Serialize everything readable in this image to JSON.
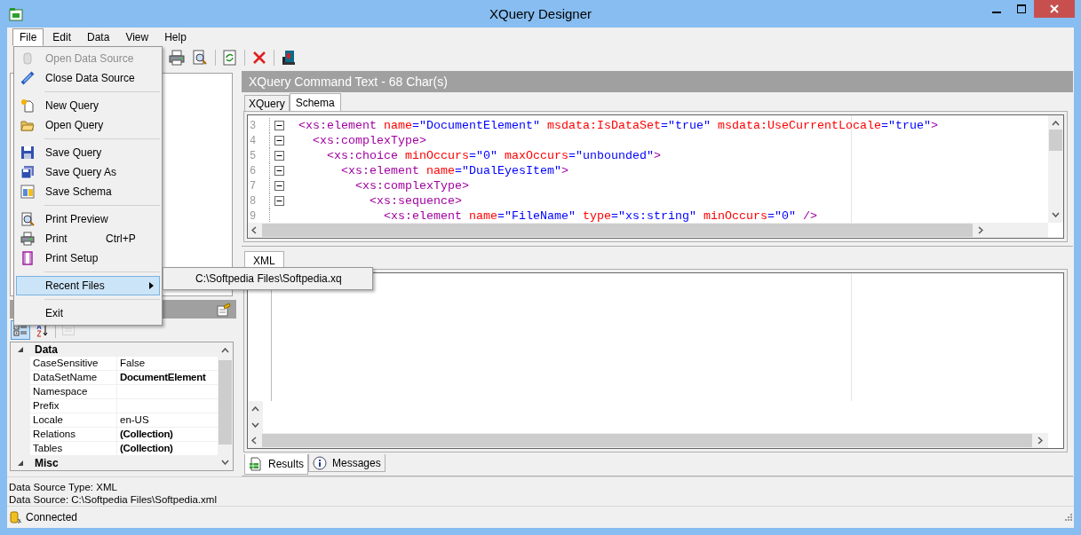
{
  "window": {
    "title": "XQuery Designer"
  },
  "menu_bar": [
    {
      "label": "File",
      "selected": true
    },
    {
      "label": "Edit",
      "selected": false
    },
    {
      "label": "Data",
      "selected": false
    },
    {
      "label": "View",
      "selected": false
    },
    {
      "label": "Help",
      "selected": false
    }
  ],
  "file_menu": [
    {
      "kind": "item",
      "label": "Open Data Source",
      "disabled": true,
      "selected": false
    },
    {
      "kind": "item",
      "label": "Close Data Source",
      "disabled": false,
      "selected": false
    },
    {
      "kind": "separator"
    },
    {
      "kind": "item",
      "label": "New Query",
      "disabled": false,
      "selected": false
    },
    {
      "kind": "item",
      "label": "Open Query",
      "disabled": false,
      "selected": false
    },
    {
      "kind": "separator"
    },
    {
      "kind": "item",
      "label": "Save Query",
      "disabled": false,
      "selected": false
    },
    {
      "kind": "item",
      "label": "Save Query As",
      "disabled": false,
      "selected": false
    },
    {
      "kind": "item",
      "label": "Save Schema",
      "disabled": false,
      "selected": false
    },
    {
      "kind": "separator"
    },
    {
      "kind": "item",
      "label": "Print Preview",
      "disabled": false,
      "selected": false
    },
    {
      "kind": "item",
      "label": "Print",
      "shortcut": "Ctrl+P",
      "disabled": false,
      "selected": false
    },
    {
      "kind": "item",
      "label": "Print Setup",
      "disabled": false,
      "selected": false
    },
    {
      "kind": "separator"
    },
    {
      "kind": "item",
      "label": "Recent Files",
      "submenu": true,
      "disabled": false,
      "selected": true
    },
    {
      "kind": "separator"
    },
    {
      "kind": "item",
      "label": "Exit",
      "disabled": false,
      "selected": false
    }
  ],
  "recent_files_submenu": [
    {
      "label": "C:\\Softpedia Files\\Softpedia.xq"
    }
  ],
  "property_toolbar": [
    {
      "kind": "categorized",
      "selected": true,
      "disabled": false
    },
    {
      "kind": "alphabetical",
      "selected": false,
      "disabled": false
    },
    {
      "kind": "pages",
      "selected": false,
      "disabled": true
    }
  ],
  "property_grid": [
    {
      "category": "Data",
      "expanded": true,
      "rows": [
        {
          "name": "CaseSensitive",
          "value": "False",
          "modified": false
        },
        {
          "name": "DataSetName",
          "value": "DocumentElement",
          "modified": true
        },
        {
          "name": "Namespace",
          "value": "",
          "modified": false
        },
        {
          "name": "Prefix",
          "value": "",
          "modified": false
        },
        {
          "name": "Locale",
          "value": "en-US",
          "modified": false
        },
        {
          "name": "Relations",
          "value": "(Collection)",
          "modified": true
        },
        {
          "name": "Tables",
          "value": "(Collection)",
          "modified": true
        }
      ]
    },
    {
      "category": "Misc",
      "expanded": true
    }
  ],
  "info_lines": [
    "Data Source Type: XML",
    "Data Source: C:\\Softpedia Files\\Softpedia.xml"
  ],
  "status_bar": {
    "text": "Connected"
  },
  "query_panel": {
    "header": "XQuery Command Text - 68 Char(s)",
    "tabs": [
      {
        "label": "XQuery",
        "selected": false
      },
      {
        "label": "Schema",
        "selected": true
      }
    ],
    "lines": [
      {
        "number": "3",
        "foldable": true,
        "tokens": [
          {
            "kind": "tag",
            "text": "<xs:element"
          },
          {
            "kind": "attr",
            "text": " name"
          },
          {
            "kind": "value",
            "text": "=\"DocumentElement\""
          },
          {
            "kind": "attr",
            "text": " msdata:IsDataSet"
          },
          {
            "kind": "value",
            "text": "=\"true\""
          },
          {
            "kind": "attr",
            "text": " msdata:UseCurrentLocale"
          },
          {
            "kind": "value",
            "text": "=\"true\""
          },
          {
            "kind": "tag",
            "text": ">"
          }
        ]
      },
      {
        "number": "4",
        "foldable": true,
        "tokens": [
          {
            "kind": "tag",
            "text": "  <xs:complexType>"
          }
        ]
      },
      {
        "number": "5",
        "foldable": true,
        "tokens": [
          {
            "kind": "tag",
            "text": "    <xs:choice"
          },
          {
            "kind": "attr",
            "text": " minOccurs"
          },
          {
            "kind": "value",
            "text": "=\"0\""
          },
          {
            "kind": "attr",
            "text": " maxOccurs"
          },
          {
            "kind": "value",
            "text": "=\"unbounded\""
          },
          {
            "kind": "tag",
            "text": ">"
          }
        ]
      },
      {
        "number": "6",
        "foldable": true,
        "tokens": [
          {
            "kind": "tag",
            "text": "      <xs:element"
          },
          {
            "kind": "attr",
            "text": " name"
          },
          {
            "kind": "value",
            "text": "=\"DualEyesItem\""
          },
          {
            "kind": "tag",
            "text": ">"
          }
        ]
      },
      {
        "number": "7",
        "foldable": true,
        "tokens": [
          {
            "kind": "tag",
            "text": "        <xs:complexType>"
          }
        ]
      },
      {
        "number": "8",
        "foldable": true,
        "tokens": [
          {
            "kind": "tag",
            "text": "          <xs:sequence>"
          }
        ]
      },
      {
        "number": "9",
        "foldable": false,
        "tokens": [
          {
            "kind": "tag",
            "text": "            <xs:element"
          },
          {
            "kind": "attr",
            "text": " name"
          },
          {
            "kind": "value",
            "text": "=\"FileName\""
          },
          {
            "kind": "attr",
            "text": " type"
          },
          {
            "kind": "value",
            "text": "=\"xs:string\""
          },
          {
            "kind": "attr",
            "text": " minOccurs"
          },
          {
            "kind": "value",
            "text": "=\"0\""
          },
          {
            "kind": "tag",
            "text": " />"
          }
        ]
      }
    ]
  },
  "result_panel": {
    "tabs": [
      {
        "label": "XML",
        "selected": true
      }
    ],
    "bottom_tabs": [
      {
        "kind": "results",
        "label": "Results",
        "selected": true
      },
      {
        "kind": "messages",
        "label": "Messages",
        "selected": false
      }
    ]
  }
}
